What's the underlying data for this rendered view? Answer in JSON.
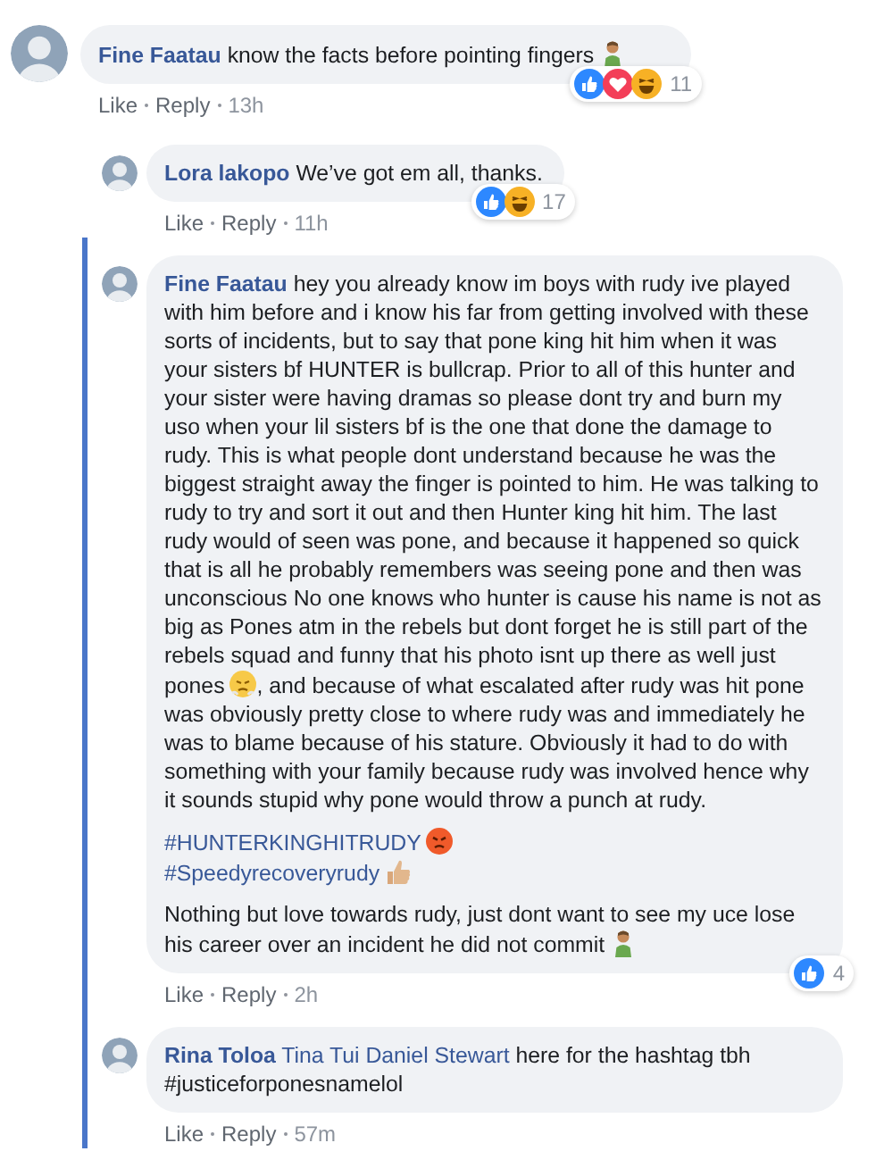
{
  "comments": [
    {
      "author": "Fine Faatau",
      "body": [
        [
          [
            {
              "kind": "text",
              "text": "know the facts before pointing fingers"
            },
            {
              "kind": "person"
            }
          ]
        ]
      ],
      "reactions": {
        "kinds": [
          {
            "kind": "like"
          },
          {
            "kind": "love"
          },
          {
            "kind": "haha"
          }
        ],
        "count": "11"
      },
      "actions": {
        "like": "Like",
        "reply": "Reply",
        "time": "13h"
      },
      "children": [
        {
          "author": "Lora lakopo",
          "highlighted": false,
          "body": [
            [
              [
                {
                  "kind": "text",
                  "text": "We’ve got em all, thanks."
                }
              ]
            ]
          ],
          "reactions": {
            "kinds": [
              {
                "kind": "like"
              },
              {
                "kind": "haha"
              }
            ],
            "count": "17"
          },
          "actions": {
            "like": "Like",
            "reply": "Reply",
            "time": "11h"
          }
        },
        {
          "author": "Fine Faatau",
          "highlighted": true,
          "body": [
            [
              [
                {
                  "kind": "text",
                  "text": "hey you already know im boys with rudy ive played with him before and i know his far from getting involved with these sorts of incidents, but to say that pone king hit him when it was your sisters bf HUNTER is bullcrap. Prior to all of this hunter and your sister were having dramas so please dont try and burn my uso when your lil sisters bf is the one that done the damage to rudy. This is what people dont understand because he was the biggest straight away the finger is pointed to him. He was talking to rudy to try and sort it out and then Hunter king hit him. The last rudy would of seen was pone, and because it happened so quick that is all he probably remembers was seeing pone and then was unconscious No one knows who hunter is cause his name is not as big as Pones atm in the rebels but dont forget he is still part of the rebels squad and funny that his photo isnt up there as well just pones"
                },
                {
                  "kind": "steam-face"
                },
                {
                  "kind": "text",
                  "text": ", and because of what escalated after rudy was hit pone was obviously pretty close to where rudy was and immediately he was to blame because of his stature. Obviously it had to do with something with your family because rudy was involved hence why it sounds stupid why pone would throw a punch at rudy."
                }
              ]
            ],
            [
              [
                {
                  "kind": "hashtag",
                  "text": "#HUNTERKINGHITRUDY"
                },
                {
                  "kind": "angry-face"
                }
              ],
              [
                {
                  "kind": "hashtag",
                  "text": "#Speedyrecoveryrudy"
                },
                {
                  "kind": "thumbs"
                }
              ]
            ],
            [
              [
                {
                  "kind": "text",
                  "text": "Nothing but love towards rudy, just dont want to see my uce lose his career over an incident he did not commit"
                },
                {
                  "kind": "person"
                }
              ]
            ]
          ],
          "reactions": {
            "kinds": [
              {
                "kind": "like"
              }
            ],
            "count": "4"
          },
          "actions": {
            "like": "Like",
            "reply": "Reply",
            "time": "2h"
          }
        },
        {
          "author": "Rina Toloa",
          "highlighted": true,
          "body": [
            [
              [
                {
                  "kind": "mention",
                  "text": "Tina Tui Daniel Stewart"
                },
                {
                  "kind": "text",
                  "text": "here for the hashtag tbh #justiceforponesnamelol"
                }
              ]
            ]
          ],
          "actions": {
            "like": "Like",
            "reply": "Reply",
            "time": "57m"
          }
        }
      ]
    }
  ]
}
